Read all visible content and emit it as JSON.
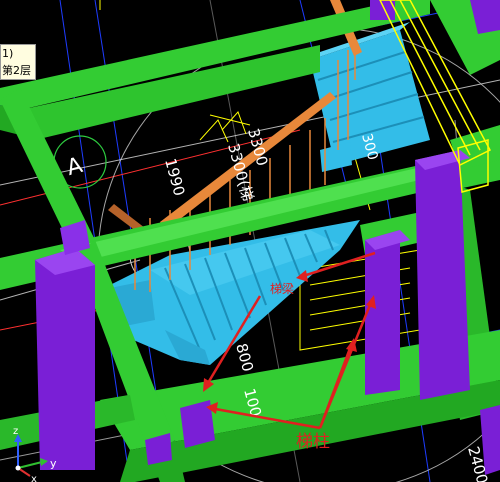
{
  "tooltip": {
    "line1": "1)",
    "line2": "第2层"
  },
  "dimensions": {
    "d1": "3300",
    "d2": "3300(梯",
    "d3": "1990",
    "d4": "300",
    "d5": "800",
    "d6": "100",
    "d7": "2400"
  },
  "annotations": {
    "beam_label": "梯梁",
    "column_label": "梯柱"
  },
  "axis_labels": {
    "axis_a": "A"
  },
  "triad": {
    "x_label": "x",
    "y_label": "y",
    "z_label": "z"
  },
  "colors": {
    "background": "#000000",
    "beam_green": "#33cc33",
    "column_purple": "#7a1fd6",
    "stair_blue": "#33bde8",
    "rail_orange": "#e8883a",
    "annotation_red": "#e02020",
    "selection_yellow": "#ffff00"
  }
}
